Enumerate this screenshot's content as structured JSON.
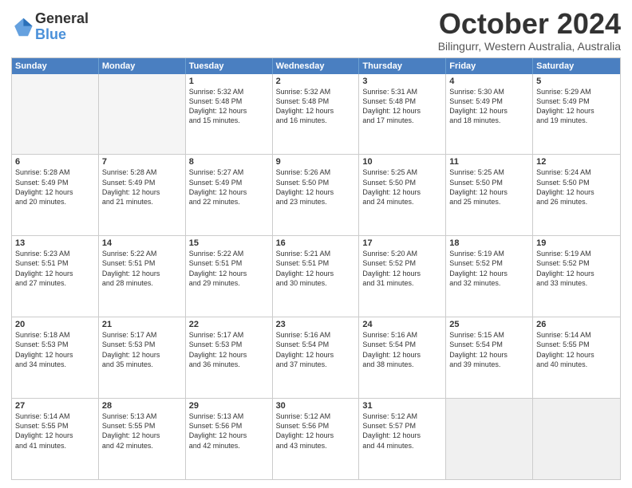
{
  "logo": {
    "line1": "General",
    "line2": "Blue"
  },
  "title": "October 2024",
  "subtitle": "Bilingurr, Western Australia, Australia",
  "weekdays": [
    "Sunday",
    "Monday",
    "Tuesday",
    "Wednesday",
    "Thursday",
    "Friday",
    "Saturday"
  ],
  "rows": [
    [
      {
        "day": "",
        "empty": true,
        "lines": []
      },
      {
        "day": "",
        "empty": true,
        "lines": []
      },
      {
        "day": "1",
        "lines": [
          "Sunrise: 5:32 AM",
          "Sunset: 5:48 PM",
          "Daylight: 12 hours",
          "and 15 minutes."
        ]
      },
      {
        "day": "2",
        "lines": [
          "Sunrise: 5:32 AM",
          "Sunset: 5:48 PM",
          "Daylight: 12 hours",
          "and 16 minutes."
        ]
      },
      {
        "day": "3",
        "lines": [
          "Sunrise: 5:31 AM",
          "Sunset: 5:48 PM",
          "Daylight: 12 hours",
          "and 17 minutes."
        ]
      },
      {
        "day": "4",
        "lines": [
          "Sunrise: 5:30 AM",
          "Sunset: 5:49 PM",
          "Daylight: 12 hours",
          "and 18 minutes."
        ]
      },
      {
        "day": "5",
        "lines": [
          "Sunrise: 5:29 AM",
          "Sunset: 5:49 PM",
          "Daylight: 12 hours",
          "and 19 minutes."
        ]
      }
    ],
    [
      {
        "day": "6",
        "lines": [
          "Sunrise: 5:28 AM",
          "Sunset: 5:49 PM",
          "Daylight: 12 hours",
          "and 20 minutes."
        ]
      },
      {
        "day": "7",
        "lines": [
          "Sunrise: 5:28 AM",
          "Sunset: 5:49 PM",
          "Daylight: 12 hours",
          "and 21 minutes."
        ]
      },
      {
        "day": "8",
        "lines": [
          "Sunrise: 5:27 AM",
          "Sunset: 5:49 PM",
          "Daylight: 12 hours",
          "and 22 minutes."
        ]
      },
      {
        "day": "9",
        "lines": [
          "Sunrise: 5:26 AM",
          "Sunset: 5:50 PM",
          "Daylight: 12 hours",
          "and 23 minutes."
        ]
      },
      {
        "day": "10",
        "lines": [
          "Sunrise: 5:25 AM",
          "Sunset: 5:50 PM",
          "Daylight: 12 hours",
          "and 24 minutes."
        ]
      },
      {
        "day": "11",
        "lines": [
          "Sunrise: 5:25 AM",
          "Sunset: 5:50 PM",
          "Daylight: 12 hours",
          "and 25 minutes."
        ]
      },
      {
        "day": "12",
        "lines": [
          "Sunrise: 5:24 AM",
          "Sunset: 5:50 PM",
          "Daylight: 12 hours",
          "and 26 minutes."
        ]
      }
    ],
    [
      {
        "day": "13",
        "lines": [
          "Sunrise: 5:23 AM",
          "Sunset: 5:51 PM",
          "Daylight: 12 hours",
          "and 27 minutes."
        ]
      },
      {
        "day": "14",
        "lines": [
          "Sunrise: 5:22 AM",
          "Sunset: 5:51 PM",
          "Daylight: 12 hours",
          "and 28 minutes."
        ]
      },
      {
        "day": "15",
        "lines": [
          "Sunrise: 5:22 AM",
          "Sunset: 5:51 PM",
          "Daylight: 12 hours",
          "and 29 minutes."
        ]
      },
      {
        "day": "16",
        "lines": [
          "Sunrise: 5:21 AM",
          "Sunset: 5:51 PM",
          "Daylight: 12 hours",
          "and 30 minutes."
        ]
      },
      {
        "day": "17",
        "lines": [
          "Sunrise: 5:20 AM",
          "Sunset: 5:52 PM",
          "Daylight: 12 hours",
          "and 31 minutes."
        ]
      },
      {
        "day": "18",
        "lines": [
          "Sunrise: 5:19 AM",
          "Sunset: 5:52 PM",
          "Daylight: 12 hours",
          "and 32 minutes."
        ]
      },
      {
        "day": "19",
        "lines": [
          "Sunrise: 5:19 AM",
          "Sunset: 5:52 PM",
          "Daylight: 12 hours",
          "and 33 minutes."
        ]
      }
    ],
    [
      {
        "day": "20",
        "lines": [
          "Sunrise: 5:18 AM",
          "Sunset: 5:53 PM",
          "Daylight: 12 hours",
          "and 34 minutes."
        ]
      },
      {
        "day": "21",
        "lines": [
          "Sunrise: 5:17 AM",
          "Sunset: 5:53 PM",
          "Daylight: 12 hours",
          "and 35 minutes."
        ]
      },
      {
        "day": "22",
        "lines": [
          "Sunrise: 5:17 AM",
          "Sunset: 5:53 PM",
          "Daylight: 12 hours",
          "and 36 minutes."
        ]
      },
      {
        "day": "23",
        "lines": [
          "Sunrise: 5:16 AM",
          "Sunset: 5:54 PM",
          "Daylight: 12 hours",
          "and 37 minutes."
        ]
      },
      {
        "day": "24",
        "lines": [
          "Sunrise: 5:16 AM",
          "Sunset: 5:54 PM",
          "Daylight: 12 hours",
          "and 38 minutes."
        ]
      },
      {
        "day": "25",
        "lines": [
          "Sunrise: 5:15 AM",
          "Sunset: 5:54 PM",
          "Daylight: 12 hours",
          "and 39 minutes."
        ]
      },
      {
        "day": "26",
        "lines": [
          "Sunrise: 5:14 AM",
          "Sunset: 5:55 PM",
          "Daylight: 12 hours",
          "and 40 minutes."
        ]
      }
    ],
    [
      {
        "day": "27",
        "lines": [
          "Sunrise: 5:14 AM",
          "Sunset: 5:55 PM",
          "Daylight: 12 hours",
          "and 41 minutes."
        ]
      },
      {
        "day": "28",
        "lines": [
          "Sunrise: 5:13 AM",
          "Sunset: 5:55 PM",
          "Daylight: 12 hours",
          "and 42 minutes."
        ]
      },
      {
        "day": "29",
        "lines": [
          "Sunrise: 5:13 AM",
          "Sunset: 5:56 PM",
          "Daylight: 12 hours",
          "and 42 minutes."
        ]
      },
      {
        "day": "30",
        "lines": [
          "Sunrise: 5:12 AM",
          "Sunset: 5:56 PM",
          "Daylight: 12 hours",
          "and 43 minutes."
        ]
      },
      {
        "day": "31",
        "lines": [
          "Sunrise: 5:12 AM",
          "Sunset: 5:57 PM",
          "Daylight: 12 hours",
          "and 44 minutes."
        ]
      },
      {
        "day": "",
        "empty": true,
        "shaded": true,
        "lines": []
      },
      {
        "day": "",
        "empty": true,
        "shaded": true,
        "lines": []
      }
    ]
  ]
}
